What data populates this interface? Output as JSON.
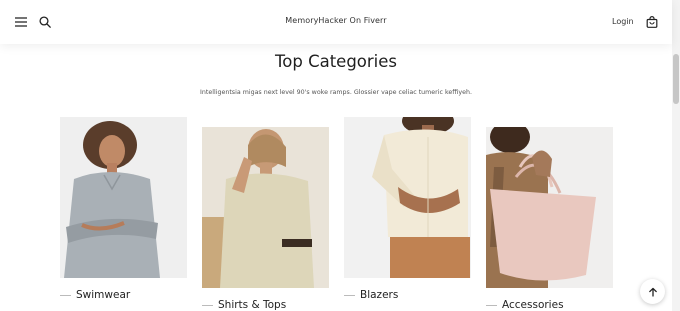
{
  "header": {
    "brand": "MemoryHacker On Fiverr",
    "login_label": "Login",
    "icons": [
      "menu-icon",
      "search-icon",
      "shopping-bag-icon"
    ]
  },
  "section": {
    "title": "Top Categories",
    "subtitle": "Intelligentsia migas next level 90's woke ramps. Glossier vape celiac tumeric keffiyeh."
  },
  "categories": [
    {
      "label": "Swimwear",
      "image": "woman-in-grey-denim-shirt"
    },
    {
      "label": "Shirts & Tops",
      "image": "woman-in-checked-shirt"
    },
    {
      "label": "Blazers",
      "image": "woman-in-cream-cardigan"
    },
    {
      "label": "Accessories",
      "image": "woman-with-pink-tote-bag"
    }
  ],
  "colors": {
    "background": "#ffffff",
    "text": "#222222",
    "muted": "#555555"
  },
  "scroll_to_top_icon": "arrow-up-icon"
}
